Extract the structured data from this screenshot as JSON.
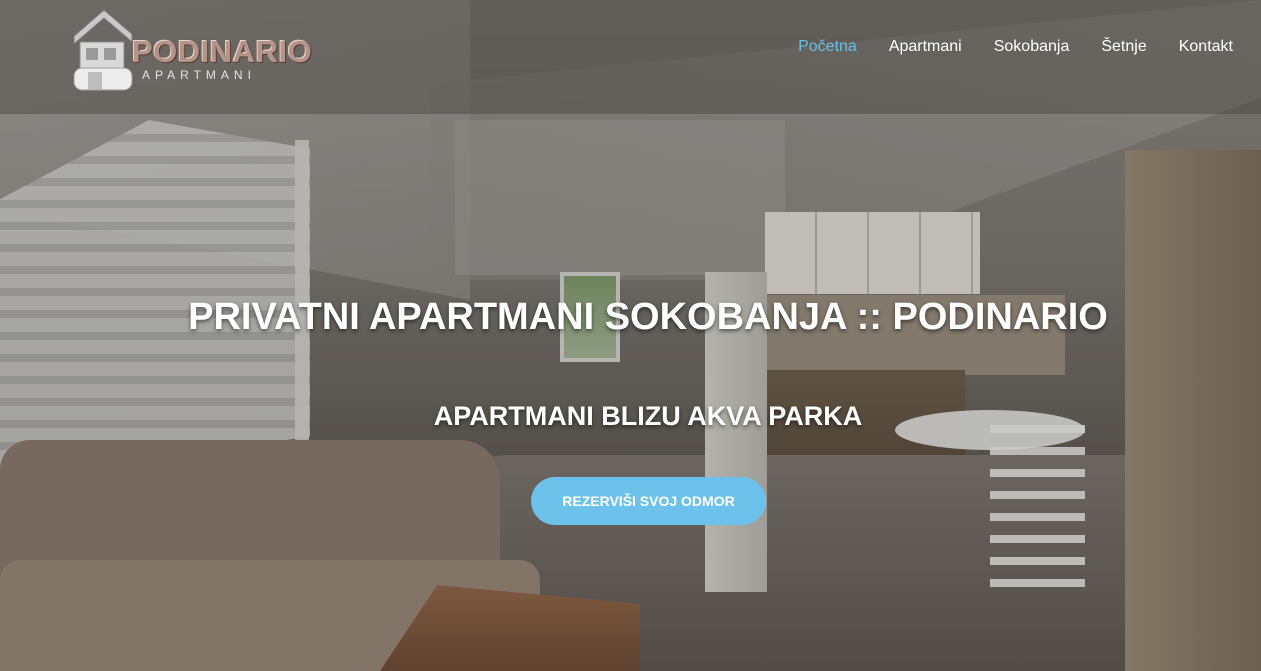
{
  "header": {
    "logo": {
      "word": "PODINARIO",
      "sub": "APARTMANI",
      "icon": "house-icon"
    },
    "nav": [
      {
        "label": "Početna",
        "active": true
      },
      {
        "label": "Apartmani",
        "active": false
      },
      {
        "label": "Sokobanja",
        "active": false
      },
      {
        "label": "Šetnje",
        "active": false
      },
      {
        "label": "Kontakt",
        "active": false
      }
    ]
  },
  "hero": {
    "title": "PRIVATNI APARTMANI SOKOBANJA :: PODINARIO",
    "subtitle": "APARTMANI BLIZU AKVA PARKA",
    "cta_label": "REZERVIŠI SVOJ ODMOR"
  },
  "colors": {
    "accent": "#69bfe6",
    "button": "#6cc2ea",
    "text": "#ffffff"
  }
}
